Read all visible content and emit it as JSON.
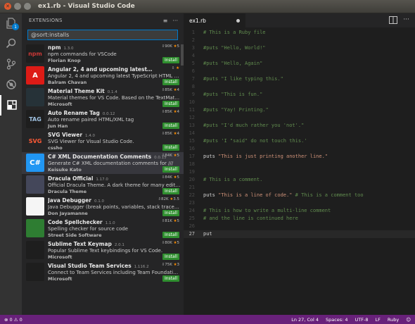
{
  "window": {
    "title": "ex1.rb - Visual Studio Code"
  },
  "activity": {
    "badge": "1"
  },
  "sidebar": {
    "title": "EXTENSIONS",
    "actions": [
      "≡",
      "···"
    ],
    "search_value": "@sort:installs"
  },
  "extensions": [
    {
      "name": "npm",
      "version": "1.3.0",
      "downloads": "90K",
      "rating": "5",
      "desc": "npm commands for VSCode",
      "author": "Florian Knop",
      "install": "Install",
      "icon_text": "npm",
      "icon_bg": "#1e1e1e",
      "icon_color": "#cb3837"
    },
    {
      "name": "Angular 2, 4 and upcoming latest TypeScript HTM...",
      "version": "",
      "downloads": "",
      "rating": "",
      "desc": "Angular 2, 4 and upcoming latest TypeScript HTML E...",
      "author": "Balram Chavan",
      "install": "Install",
      "icon_text": "A",
      "icon_bg": "#dd1b16",
      "icon_color": "#ffffff"
    },
    {
      "name": "Material Theme Kit",
      "version": "0.1.4",
      "downloads": "85K",
      "rating": "4",
      "desc": "Material themes for VS Code. Based on the TextMat...",
      "author": "Microsoft",
      "install": "Install",
      "icon_text": "",
      "icon_bg": "#263238",
      "icon_color": "#ffffff"
    },
    {
      "name": "Auto Rename Tag",
      "version": "0.0.12",
      "downloads": "85K",
      "rating": "4",
      "desc": "Auto rename paired HTML/XML tag",
      "author": "Jun Han",
      "install": "Install",
      "icon_text": "TAG",
      "icon_bg": "#1e1e1e",
      "icon_color": "#9ec0e0"
    },
    {
      "name": "SVG Viewer",
      "version": "1.4.0",
      "downloads": "85K",
      "rating": "4",
      "desc": "SVG Viewer for Visual Studio Code.",
      "author": "cssho",
      "install": "Install",
      "icon_text": "SVG",
      "icon_bg": "#252526",
      "icon_color": "#ff5a36"
    },
    {
      "name": "C# XML Documentation Comments",
      "version": "0.0.15",
      "downloads": "84K",
      "rating": "5",
      "desc": "Generate C# XML documentation comments for ///",
      "author": "Keisuke Kato",
      "install": "Install",
      "icon_text": "C#",
      "icon_bg": "#2196f3",
      "icon_color": "#ffffff"
    },
    {
      "name": "Dracula Official",
      "version": "1.17.0",
      "downloads": "84K",
      "rating": "5",
      "desc": "Official Dracula Theme. A dark theme for many edito...",
      "author": "Dracula Theme",
      "install": "Install",
      "icon_text": "",
      "icon_bg": "#44475a",
      "icon_color": "#ffffff"
    },
    {
      "name": "Java Debugger",
      "version": "0.1.0",
      "downloads": "82K",
      "rating": "3.5",
      "desc": "Java Debugger (break points, variables, stack trace e...",
      "author": "Don Jayamanne",
      "install": "Install",
      "icon_text": "",
      "icon_bg": "#f5f5f5",
      "icon_color": "#e76f00"
    },
    {
      "name": "Code Spellchecker",
      "version": "1.1.0",
      "downloads": "81K",
      "rating": "5",
      "desc": "Spelling checker for source code",
      "author": "Street Side Software",
      "install": "Install",
      "icon_text": "",
      "icon_bg": "#2e7d32",
      "icon_color": "#ffffff"
    },
    {
      "name": "Sublime Text Keymap",
      "version": "2.0.1",
      "downloads": "80K",
      "rating": "5",
      "desc": "Popular Sublime Text keybindings for VS Code.",
      "author": "Microsoft",
      "install": "Install",
      "icon_text": "",
      "icon_bg": "#1e1e1e",
      "icon_color": "#cccccc"
    },
    {
      "name": "Visual Studio Team Services",
      "version": "1.116.2",
      "downloads": "75K",
      "rating": "3",
      "desc": "Connect to Team Services including Team Foundation...",
      "author": "Microsoft",
      "install": "Install",
      "icon_text": "",
      "icon_bg": "#1e1e1e",
      "icon_color": "#0078d7"
    }
  ],
  "editor": {
    "tab_label": "ex1.rb",
    "lines": [
      {
        "n": "1",
        "kind": "comment",
        "text": "# This is a Ruby file"
      },
      {
        "n": "2",
        "kind": "plain",
        "text": ""
      },
      {
        "n": "3",
        "kind": "comment",
        "text": "#puts \"Hello, World!\""
      },
      {
        "n": "4",
        "kind": "plain",
        "text": ""
      },
      {
        "n": "5",
        "kind": "comment",
        "text": "#puts \"Hello, Again\""
      },
      {
        "n": "6",
        "kind": "plain",
        "text": ""
      },
      {
        "n": "7",
        "kind": "comment",
        "text": "#puts \"I like typing this.\""
      },
      {
        "n": "8",
        "kind": "plain",
        "text": ""
      },
      {
        "n": "9",
        "kind": "comment",
        "text": "#puts \"This is fun.\""
      },
      {
        "n": "10",
        "kind": "plain",
        "text": ""
      },
      {
        "n": "11",
        "kind": "comment",
        "text": "#puts \"Yay! Printing.\""
      },
      {
        "n": "12",
        "kind": "plain",
        "text": ""
      },
      {
        "n": "13",
        "kind": "comment",
        "text": "#puts \"I'd much rather you 'not'.\""
      },
      {
        "n": "14",
        "kind": "plain",
        "text": ""
      },
      {
        "n": "15",
        "kind": "comment",
        "text": "#puts 'I \"said\" do not touch this.'"
      },
      {
        "n": "16",
        "kind": "plain",
        "text": ""
      },
      {
        "n": "17",
        "kind": "puts",
        "text": "puts ",
        "str": "\"This is just printing another line.\""
      },
      {
        "n": "18",
        "kind": "plain",
        "text": ""
      },
      {
        "n": "19",
        "kind": "plain",
        "text": ""
      },
      {
        "n": "20",
        "kind": "comment",
        "text": "# This is a comment."
      },
      {
        "n": "21",
        "kind": "plain",
        "text": ""
      },
      {
        "n": "22",
        "kind": "putscomment",
        "text": "puts ",
        "str": "\"This is a line of code.\"",
        "tail": " # This is a comment too"
      },
      {
        "n": "23",
        "kind": "plain",
        "text": ""
      },
      {
        "n": "24",
        "kind": "comment",
        "text": "# This is how to write a multi-line comment"
      },
      {
        "n": "25",
        "kind": "comment",
        "text": "# and the line is continued here"
      },
      {
        "n": "26",
        "kind": "plain",
        "text": ""
      },
      {
        "n": "27",
        "kind": "plain",
        "text": "put",
        "current": true
      }
    ]
  },
  "status": {
    "errors": "0",
    "warnings": "0",
    "position": "Ln 27, Col 4",
    "spaces": "Spaces: 4",
    "encoding": "UTF-8",
    "eol": "LF",
    "language": "Ruby"
  },
  "colors": {
    "status_bar": "#68217a",
    "accent": "#007acc",
    "install": "#2f8f2f",
    "comment": "#608b4e",
    "string": "#ce9178"
  }
}
